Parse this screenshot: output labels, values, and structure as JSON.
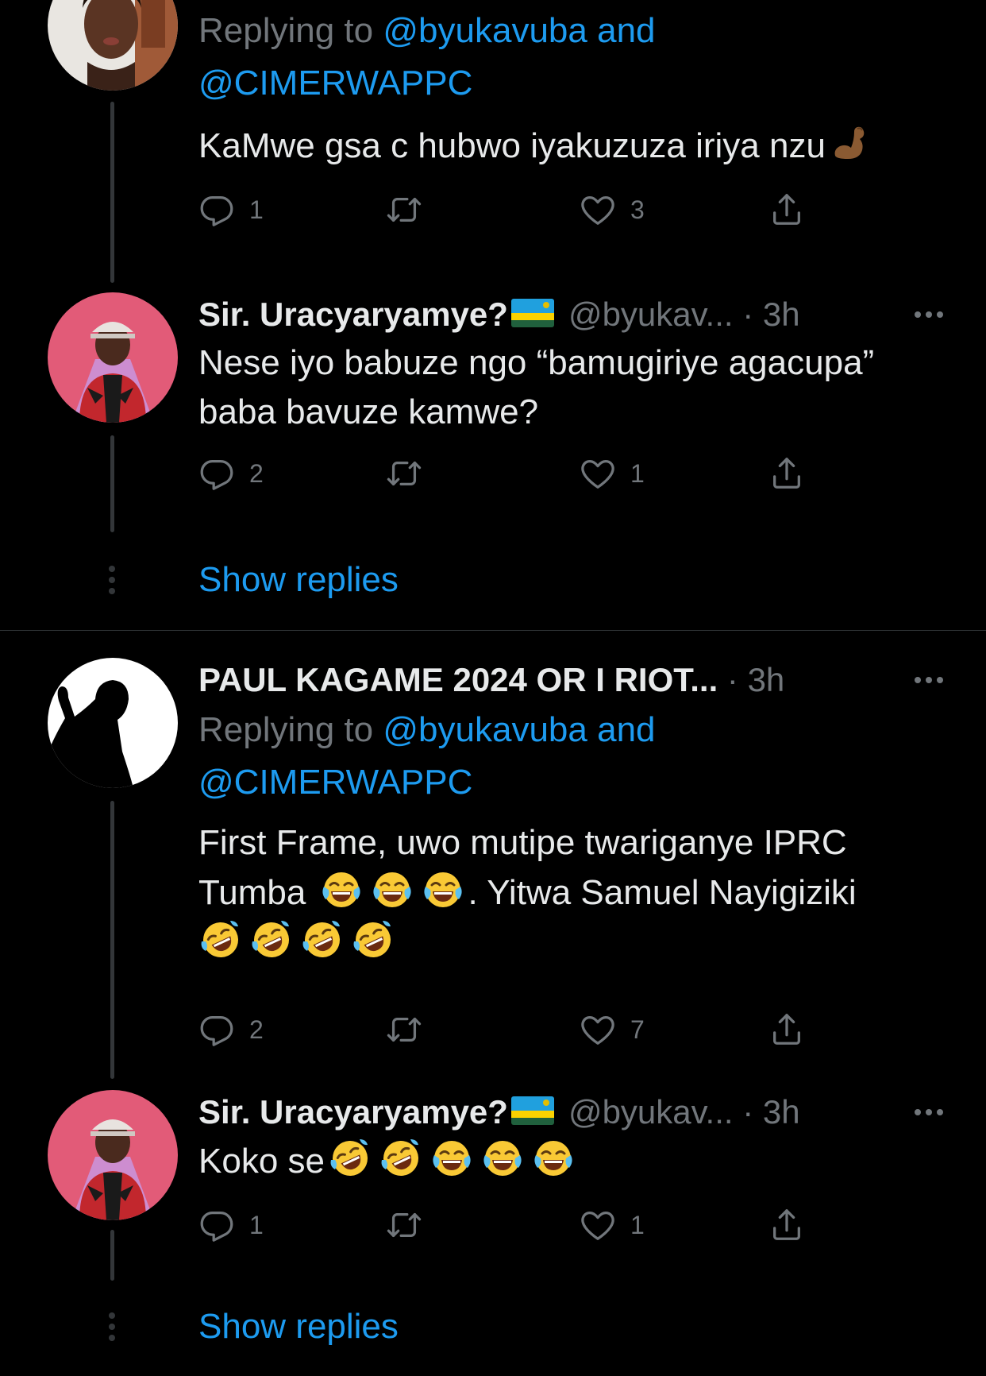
{
  "colors": {
    "background": "#000000",
    "text": "#e7e9ea",
    "muted": "#71767b",
    "link": "#1d9bf0",
    "divider": "#2f3336"
  },
  "tweets": [
    {
      "reply_prefix": "Replying to",
      "reply_handle_1": "@byukavuba",
      "reply_and": "and",
      "reply_handle_2": "@CIMERWAPPC",
      "text": "KaMwe gsa c hubwo iyakuzuza iriya nzu",
      "emoji": "flexed-biceps-emoji",
      "replies": "1",
      "likes": "3"
    },
    {
      "name": "Sir. Uracyaryamye?",
      "flag": "rwanda-flag",
      "handle": "@byukav...",
      "time": "· 3h",
      "text_line1": "Nese iyo babuze ngo “bamugiriye agacupa”",
      "text_line2": "baba bavuze kamwe?",
      "replies": "2",
      "likes": "1"
    },
    {
      "name": "PAUL KAGAME 2024 OR I RIOT...",
      "time": "· 3h",
      "reply_prefix": "Replying to",
      "reply_handle_1": "@byukavuba",
      "reply_and": "and",
      "reply_handle_2": "@CIMERWAPPC",
      "text_line1": "First Frame, uwo mutipe twariganye IPRC",
      "text_line2a": "Tumba",
      "text_line2b": ". Yitwa Samuel Nayigiziki",
      "replies": "2",
      "likes": "7"
    },
    {
      "name": "Sir. Uracyaryamye?",
      "flag": "rwanda-flag",
      "handle": "@byukav...",
      "time": "· 3h",
      "text": "Koko se",
      "replies": "1",
      "likes": "1"
    }
  ],
  "show_replies_label": "Show replies",
  "icons": {
    "reply": "reply-icon",
    "retweet": "retweet-icon",
    "like": "heart-icon",
    "share": "share-icon",
    "more": "more-icon"
  }
}
